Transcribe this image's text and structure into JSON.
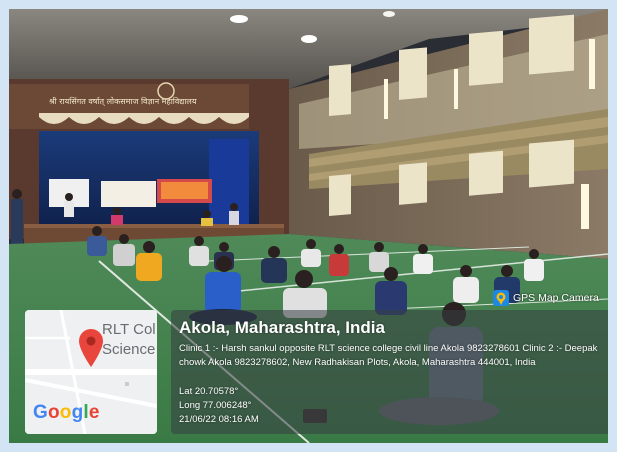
{
  "photo": {
    "banner_text": "श्री रायसिंगत वर्षात् लोकसमाज विज्ञान महाविद्यालय"
  },
  "watermark": {
    "app_name": "GPS Map Camera",
    "icon": "gps-map-camera-logo"
  },
  "map": {
    "label_line1": "RLT Col",
    "label_line2": "Science",
    "logo_text": "Google",
    "pin_color": "#e8453c"
  },
  "location": {
    "title": "Akola, Maharashtra, India",
    "address": "Clinic 1 :- Harsh sankul opposite RLT science college civil line Akola 9823278601 Clinic 2 :- Deepak chowk Akola 9823278602, New Radhakisan Plots, Akola, Maharashtra 444001, India",
    "lat": "Lat 20.70578°",
    "long": "Long 77.006248°",
    "datetime": "21/06/22 08:16 AM"
  }
}
